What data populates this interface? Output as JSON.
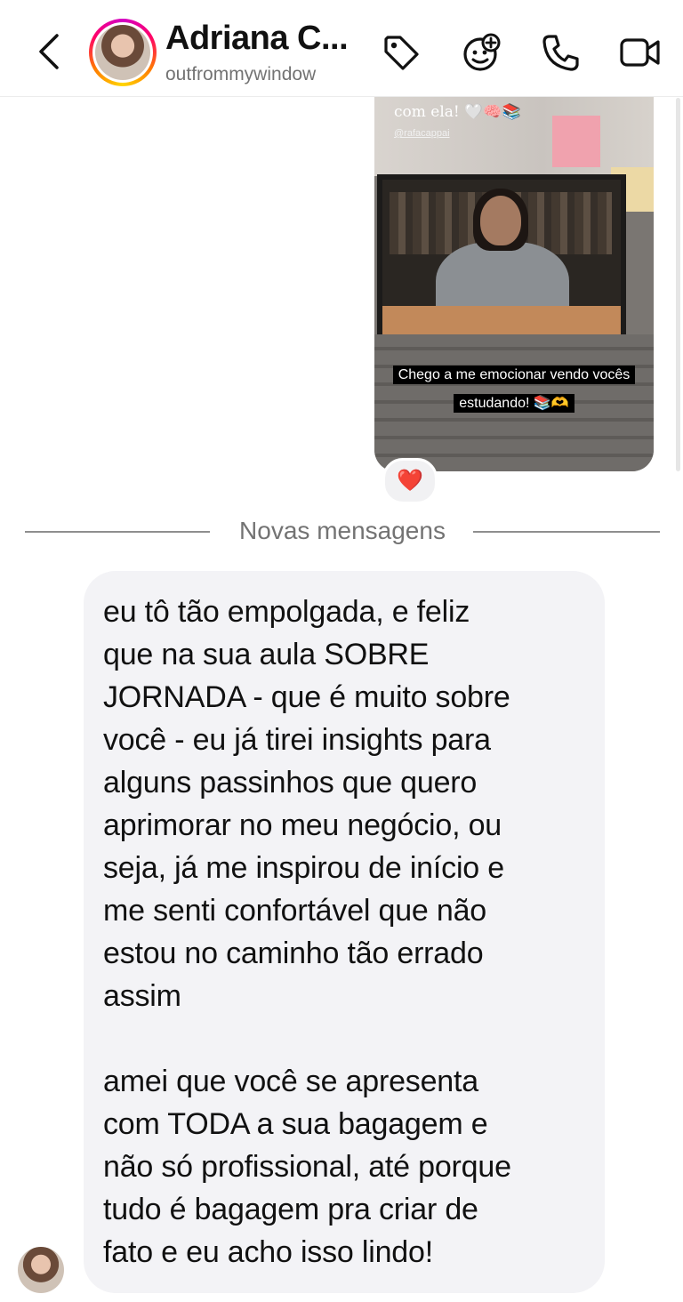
{
  "header": {
    "contact_name": "Adriana C...",
    "username": "outfrommywindow",
    "icons": {
      "back": "chevron-left-icon",
      "tag": "tag-icon",
      "effects": "face-plus-icon",
      "call": "phone-icon",
      "video": "video-camera-icon"
    }
  },
  "shared_post": {
    "top_text": "com ela! 🤍🧠📚",
    "credit": "@rafacappai",
    "caption_line1": "Chego a me emocionar vendo vocês",
    "caption_line2": "estudando! 📚🫶",
    "reaction": "❤️"
  },
  "divider": {
    "label": "Novas mensagens"
  },
  "message": {
    "text": "eu tô tão empolgada, e feliz\nque na sua aula SOBRE\nJORNADA - que é muito sobre\nvocê - eu já tirei insights para\nalguns passinhos que quero\naprimorar no meu negócio, ou\nseja, já me inspirou de início e\nme senti confortável que não\nestou no caminho tão errado\nassim\n\namei que você se apresenta\ncom TODA a sua bagagem e\nnão só profissional, até porque\ntudo é bagagem pra criar de\nfato e eu acho isso lindo!"
  },
  "colors": {
    "bubble_bg": "#f3f3f6",
    "muted_text": "#737373",
    "ring_start": "#d300c5",
    "ring_end": "#ffd600"
  }
}
